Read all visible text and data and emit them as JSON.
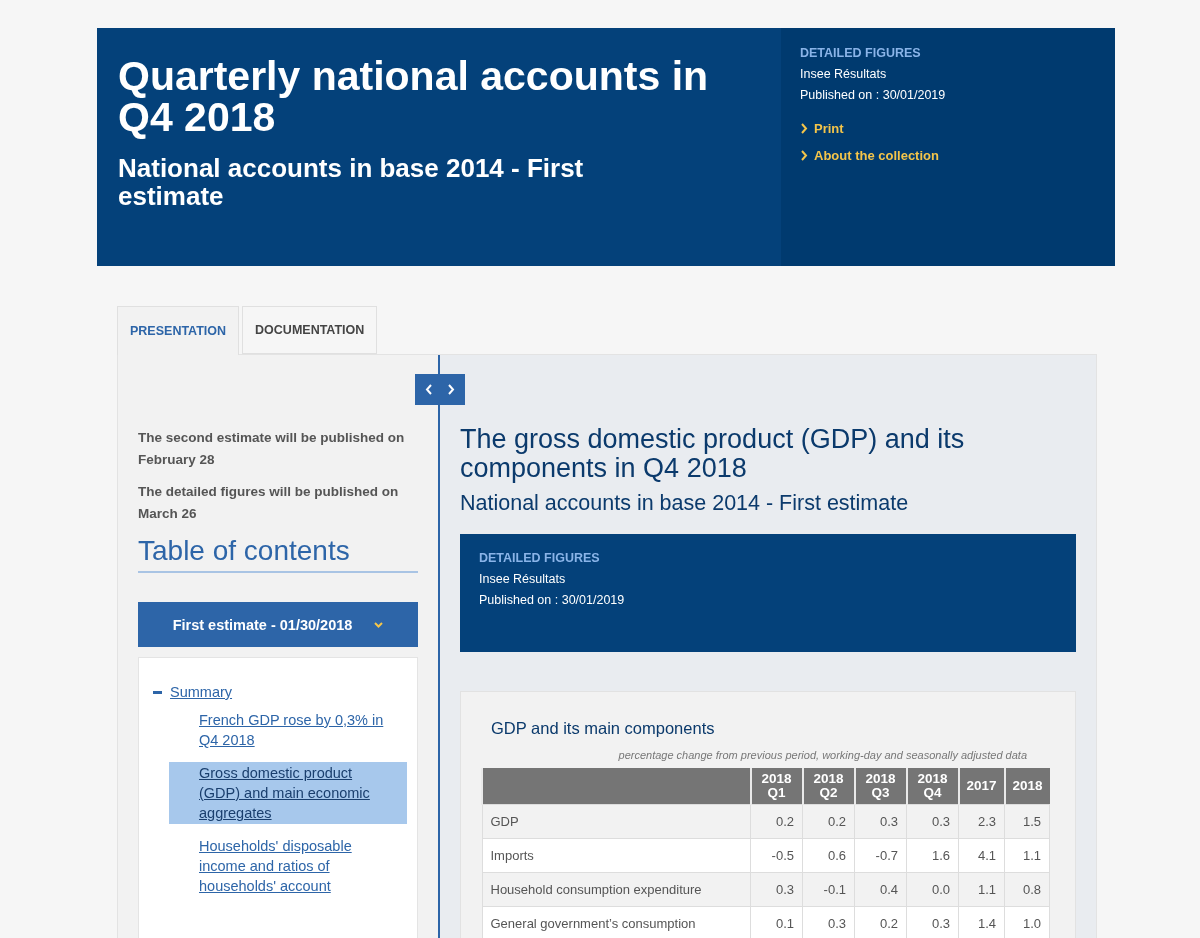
{
  "header": {
    "title": "Quarterly national accounts in Q4 2018",
    "subtitle": "National accounts in base 2014 - First estimate",
    "info": {
      "label": "DETAILED FIGURES",
      "source": "Insee Résultats",
      "published": "Published on : 30/01/2019"
    },
    "links": [
      "Print",
      "About the collection"
    ]
  },
  "tabs": [
    {
      "label": "PRESENTATION",
      "selected": true
    },
    {
      "label": "DOCUMENTATION",
      "selected": false
    }
  ],
  "sidebar": {
    "notes": [
      "The second estimate will be published on February 28",
      "The detailed figures will be published on March 26"
    ],
    "toc_title": "Table of contents",
    "dropdown": "First estimate - 01/30/2018",
    "toc": [
      {
        "label": "Summary",
        "expanded": true,
        "children": [
          {
            "label": "French GDP rose by 0,3% in Q4 2018",
            "selected": false
          },
          {
            "label": "Gross domestic product (GDP) and main economic aggregates",
            "selected": true
          },
          {
            "label": "Households' disposable income and ratios of households' account",
            "selected": false
          }
        ]
      }
    ]
  },
  "article": {
    "title": "The gross domestic product (GDP) and its components in Q4 2018",
    "subtitle": "National accounts in base 2014 - First estimate",
    "info": {
      "label": "DETAILED FIGURES",
      "source": "Insee Résultats",
      "published": "Published on : 30/01/2019"
    },
    "table": {
      "title": "GDP and its main components",
      "caption": "percentage change from previous period, working-day and seasonally adjusted data",
      "columns": [
        "2018 Q1",
        "2018 Q2",
        "2018 Q3",
        "2018 Q4",
        "2017",
        "2018"
      ],
      "rows": [
        {
          "label": "GDP",
          "values": [
            "0.2",
            "0.2",
            "0.3",
            "0.3",
            "2.3",
            "1.5"
          ]
        },
        {
          "label": "Imports",
          "values": [
            "-0.5",
            "0.6",
            "-0.7",
            "1.6",
            "4.1",
            "1.1"
          ]
        },
        {
          "label": "Household consumption expenditure",
          "values": [
            "0.3",
            "-0.1",
            "0.4",
            "0.0",
            "1.1",
            "0.8"
          ]
        },
        {
          "label": "General government’s consumption",
          "values": [
            "0.1",
            "0.3",
            "0.2",
            "0.3",
            "1.4",
            "1.0"
          ]
        }
      ]
    }
  }
}
